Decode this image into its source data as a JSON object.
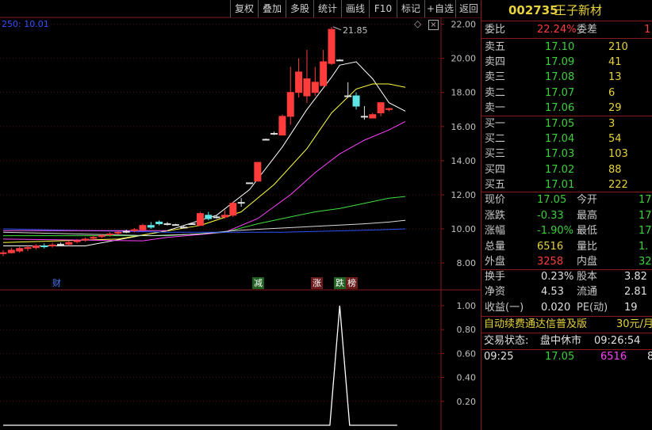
{
  "toolbar": {
    "buttons": [
      "复权",
      "叠加",
      "多股",
      "统计",
      "画线",
      "F10",
      "标记",
      "+自选",
      "返回"
    ]
  },
  "chart_indicator_label": "250: 10.01",
  "main_chart_data": {
    "type": "candlestick",
    "y_ticks": [
      "22.00",
      "20.00",
      "18.00",
      "16.00",
      "14.00",
      "12.00",
      "10.00",
      "8.00"
    ],
    "ylim": [
      7.4,
      22.4
    ],
    "max_label": "21.85",
    "candles": [
      {
        "o": 8.55,
        "c": 8.6,
        "h": 8.75,
        "l": 8.4
      },
      {
        "o": 8.6,
        "c": 8.75,
        "h": 8.9,
        "l": 8.55
      },
      {
        "o": 8.7,
        "c": 8.85,
        "h": 8.95,
        "l": 8.6
      },
      {
        "o": 8.85,
        "c": 8.9,
        "h": 9.05,
        "l": 8.7
      },
      {
        "o": 8.9,
        "c": 9.0,
        "h": 9.1,
        "l": 8.8
      },
      {
        "o": 9.0,
        "c": 8.95,
        "h": 9.15,
        "l": 8.85
      },
      {
        "o": 9.0,
        "c": 9.05,
        "h": 9.2,
        "l": 8.9
      },
      {
        "o": 9.1,
        "c": 9.1,
        "h": 9.2,
        "l": 9.0
      },
      {
        "o": 9.1,
        "c": 9.2,
        "h": 9.3,
        "l": 9.0
      },
      {
        "o": 9.25,
        "c": 9.3,
        "h": 9.4,
        "l": 9.15
      },
      {
        "o": 9.35,
        "c": 9.4,
        "h": 9.5,
        "l": 9.25
      },
      {
        "o": 9.45,
        "c": 9.5,
        "h": 9.6,
        "l": 9.35
      },
      {
        "o": 9.55,
        "c": 9.6,
        "h": 9.7,
        "l": 9.45
      },
      {
        "o": 9.65,
        "c": 9.7,
        "h": 9.8,
        "l": 9.55
      },
      {
        "o": 9.75,
        "c": 9.8,
        "h": 9.9,
        "l": 9.65
      },
      {
        "o": 9.85,
        "c": 9.85,
        "h": 9.95,
        "l": 9.75
      },
      {
        "o": 9.9,
        "c": 9.95,
        "h": 10.05,
        "l": 9.8
      },
      {
        "o": 9.95,
        "c": 10.2,
        "h": 10.3,
        "l": 9.85
      },
      {
        "o": 10.2,
        "c": 10.1,
        "h": 10.4,
        "l": 10.0
      },
      {
        "o": 10.4,
        "c": 10.3,
        "h": 10.5,
        "l": 10.2
      },
      {
        "o": 10.3,
        "c": 10.3,
        "h": 10.4,
        "l": 10.2
      },
      {
        "o": 10.25,
        "c": 10.25,
        "h": 10.3,
        "l": 10.2
      },
      {
        "o": 10.1,
        "c": 10.1,
        "h": 10.2,
        "l": 10.05
      },
      {
        "o": 10.3,
        "c": 10.3,
        "h": 10.35,
        "l": 10.25
      },
      {
        "o": 10.2,
        "c": 10.9,
        "h": 11.0,
        "l": 10.2
      },
      {
        "o": 10.8,
        "c": 10.6,
        "h": 11.0,
        "l": 10.5
      },
      {
        "o": 10.7,
        "c": 10.7,
        "h": 10.8,
        "l": 10.6
      },
      {
        "o": 10.7,
        "c": 10.8,
        "h": 11.1,
        "l": 10.6
      },
      {
        "o": 10.8,
        "c": 11.5,
        "h": 11.6,
        "l": 10.7
      },
      {
        "o": 11.55,
        "c": 11.55,
        "h": 11.8,
        "l": 11.3
      },
      {
        "o": 12.7,
        "c": 12.7,
        "h": 12.7,
        "l": 12.7
      },
      {
        "o": 12.8,
        "c": 13.9,
        "h": 13.9,
        "l": 12.8
      },
      {
        "o": 15.25,
        "c": 15.25,
        "h": 15.3,
        "l": 15.2
      },
      {
        "o": 15.6,
        "c": 15.6,
        "h": 15.7,
        "l": 15.5
      },
      {
        "o": 15.5,
        "c": 16.6,
        "h": 16.7,
        "l": 15.5
      },
      {
        "o": 16.6,
        "c": 18.0,
        "h": 19.5,
        "l": 16.1
      },
      {
        "o": 18.0,
        "c": 19.2,
        "h": 20.0,
        "l": 17.7
      },
      {
        "o": 17.8,
        "c": 18.8,
        "h": 20.5,
        "l": 17.4
      },
      {
        "o": 18.0,
        "c": 18.6,
        "h": 19.5,
        "l": 17.8
      },
      {
        "o": 18.4,
        "c": 19.8,
        "h": 20.5,
        "l": 18.4
      },
      {
        "o": 19.7,
        "c": 21.7,
        "h": 21.85,
        "l": 19.6
      },
      {
        "o": 19.9,
        "c": 19.9,
        "h": 19.95,
        "l": 19.85
      },
      {
        "o": 17.8,
        "c": 17.8,
        "h": 18.6,
        "l": 17.7
      },
      {
        "o": 17.8,
        "c": 17.2,
        "h": 18.0,
        "l": 17.0
      },
      {
        "o": 16.6,
        "c": 16.6,
        "h": 17.2,
        "l": 16.4
      },
      {
        "o": 16.5,
        "c": 16.7,
        "h": 16.8,
        "l": 16.5
      },
      {
        "o": 16.8,
        "c": 17.4,
        "h": 17.4,
        "l": 16.6
      },
      {
        "o": 17.0,
        "c": 17.05,
        "h": 17.1,
        "l": 16.9
      }
    ],
    "ma_lines": [
      {
        "color": "#ffffff",
        "points": [
          [
            0,
            9.0
          ],
          [
            10,
            9.0
          ],
          [
            20,
            9.9
          ],
          [
            26,
            10.8
          ],
          [
            30,
            12.3
          ],
          [
            34,
            14.8
          ],
          [
            37,
            17.0
          ],
          [
            40,
            18.9
          ],
          [
            41,
            19.6
          ],
          [
            43,
            19.8
          ],
          [
            45,
            18.8
          ],
          [
            47,
            17.4
          ],
          [
            49,
            16.9
          ]
        ]
      },
      {
        "color": "#ffff40",
        "points": [
          [
            0,
            9.2
          ],
          [
            14,
            9.4
          ],
          [
            24,
            10.2
          ],
          [
            29,
            11.0
          ],
          [
            33,
            12.6
          ],
          [
            37,
            14.7
          ],
          [
            40,
            16.8
          ],
          [
            43,
            18.2
          ],
          [
            45,
            18.5
          ],
          [
            47,
            18.5
          ],
          [
            49,
            18.3
          ]
        ]
      },
      {
        "color": "#ff40ff",
        "points": [
          [
            0,
            9.4
          ],
          [
            17,
            9.3
          ],
          [
            20,
            9.5
          ],
          [
            27,
            9.8
          ],
          [
            31,
            10.6
          ],
          [
            35,
            12.0
          ],
          [
            38,
            13.3
          ],
          [
            41,
            14.4
          ],
          [
            44,
            15.2
          ],
          [
            47,
            15.8
          ],
          [
            49,
            16.3
          ]
        ]
      },
      {
        "color": "#40e040",
        "points": [
          [
            0,
            9.6
          ],
          [
            20,
            9.6
          ],
          [
            27,
            9.8
          ],
          [
            31,
            10.3
          ],
          [
            35,
            10.7
          ],
          [
            38,
            11.0
          ],
          [
            41,
            11.2
          ],
          [
            44,
            11.5
          ],
          [
            47,
            11.8
          ],
          [
            49,
            11.9
          ]
        ]
      },
      {
        "color": "#d8d8d8",
        "points": [
          [
            0,
            9.8
          ],
          [
            18,
            9.6
          ],
          [
            24,
            9.7
          ],
          [
            28,
            9.9
          ],
          [
            32,
            10.0
          ],
          [
            36,
            10.1
          ],
          [
            40,
            10.2
          ],
          [
            44,
            10.3
          ],
          [
            47,
            10.4
          ],
          [
            49,
            10.5
          ]
        ]
      },
      {
        "color": "#3050ff",
        "points": [
          [
            0,
            10.0
          ],
          [
            20,
            9.8
          ],
          [
            26,
            9.8
          ],
          [
            30,
            9.8
          ],
          [
            34,
            9.8
          ],
          [
            38,
            9.85
          ],
          [
            42,
            9.9
          ],
          [
            46,
            9.95
          ],
          [
            49,
            10.0
          ]
        ]
      },
      {
        "color": "#ff60ff",
        "points": [
          [
            0,
            9.9
          ],
          [
            6,
            9.9
          ],
          [
            14,
            9.9
          ],
          [
            18,
            9.9
          ],
          [
            20,
            9.9
          ]
        ]
      }
    ]
  },
  "event_tags": [
    {
      "label": "财",
      "color": "#4a7aff",
      "bg": "#000000"
    },
    {
      "label": "减",
      "color": "#ffffff",
      "bg": "#206020"
    },
    {
      "label": "涨",
      "color": "#ffffff",
      "bg": "#6a1a1a"
    },
    {
      "label": "跌",
      "color": "#ffffff",
      "bg": "#206020"
    },
    {
      "label": "榜",
      "color": "#ffffff",
      "bg": "#6a1a1a"
    }
  ],
  "chart_data": {
    "type": "line",
    "y_ticks": [
      "1.00",
      "0.80",
      "0.60",
      "0.40",
      "0.20"
    ],
    "ylim": [
      0,
      1.0
    ],
    "spike_at_index": 41,
    "values": "0 everywhere except a single spike to 1.00"
  },
  "quote_panel": {
    "code": "002735",
    "name": "王子新材",
    "wei_bi": {
      "label": "委比",
      "value": "22.24%"
    },
    "wei_cha": {
      "label": "委差",
      "value": "1"
    },
    "asks": [
      {
        "label": "卖五",
        "price": "17.10",
        "vol": "210"
      },
      {
        "label": "卖四",
        "price": "17.09",
        "vol": "41"
      },
      {
        "label": "卖三",
        "price": "17.08",
        "vol": "13"
      },
      {
        "label": "卖二",
        "price": "17.07",
        "vol": "6"
      },
      {
        "label": "卖一",
        "price": "17.06",
        "vol": "29"
      }
    ],
    "bids": [
      {
        "label": "买一",
        "price": "17.05",
        "vol": "3"
      },
      {
        "label": "买二",
        "price": "17.04",
        "vol": "54"
      },
      {
        "label": "买三",
        "price": "17.03",
        "vol": "103"
      },
      {
        "label": "买四",
        "price": "17.02",
        "vol": "88"
      },
      {
        "label": "买五",
        "price": "17.01",
        "vol": "222"
      }
    ],
    "stats": [
      {
        "l1": "现价",
        "v1": "17.05",
        "c1": "green",
        "l2": "今开",
        "v2": "17."
      },
      {
        "l1": "涨跌",
        "v1": "-0.33",
        "c1": "green",
        "l2": "最高",
        "v2": "17."
      },
      {
        "l1": "涨幅",
        "v1": "-1.90%",
        "c1": "green",
        "l2": "最低",
        "v2": "17."
      },
      {
        "l1": "总量",
        "v1": "6516",
        "c1": "yellow",
        "l2": "量比",
        "v2": "1."
      },
      {
        "l1": "外盘",
        "v1": "3258",
        "c1": "red",
        "l2": "内盘",
        "v2": "32"
      }
    ],
    "fin": [
      {
        "l1": "换手",
        "v1": "0.23%",
        "l2": "股本",
        "v2": "3.82"
      },
      {
        "l1": "净资",
        "v1": "4.53",
        "l2": "流通",
        "v2": "2.81"
      },
      {
        "l1": "收益(一)",
        "v1": "0.020",
        "l2": "PE(动)",
        "v2": "19"
      }
    ],
    "ad_text": "自动续费通达信普及版",
    "ad_price": "30元/月",
    "trade_status_label": "交易状态:",
    "trade_status": "盘中休市",
    "trade_time": "09:26:54",
    "tick": {
      "time": "09:25",
      "price": "17.05",
      "vol": "6516",
      "extra": "8"
    }
  }
}
